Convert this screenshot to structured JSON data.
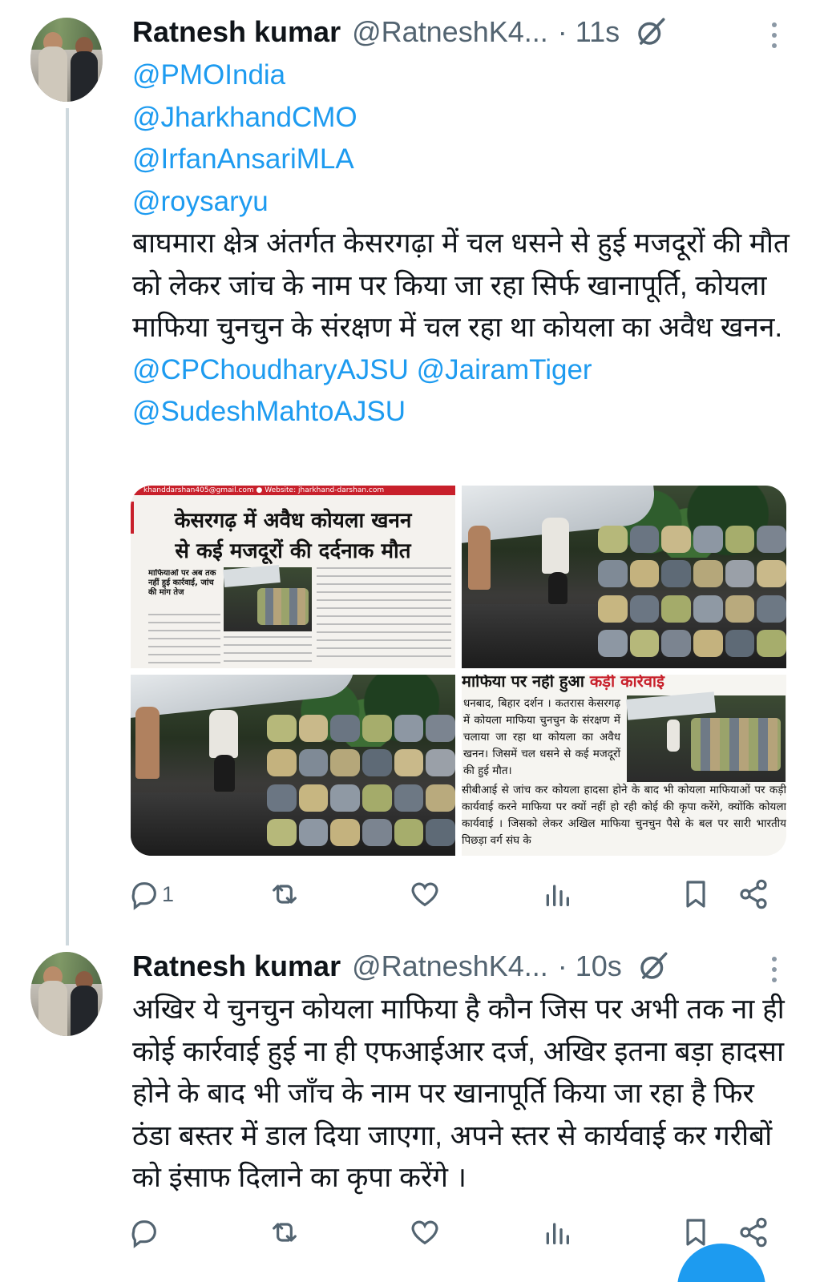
{
  "tweets": [
    {
      "author_name": "Ratnesh kumar",
      "author_handle": "@RatneshK4...",
      "time": "· 11s",
      "mentions_top": [
        "@PMOIndia",
        "@JharkhandCMO",
        "@IrfanAnsariMLA",
        "@roysaryu"
      ],
      "text": "बाघमारा क्षेत्र अंतर्गत केसरगढ़ा में चल धसने से हुई मजदूरों की मौत को लेकर जांच के नाम पर किया जा रहा सिर्फ खानापूर्ति, कोयला माफिया चुनचुन के संरक्षण में चल रहा था कोयला का अवैध खनन.",
      "mentions_bottom_line1_a": "@CPChoudharyAJSU",
      "mentions_bottom_line1_b": "@JairamTiger",
      "mentions_bottom_line2": "@SudeshMahtoAJSU",
      "reply_count": "1",
      "media": {
        "newspaper1": {
          "strip": "khanddarshan405@gmail.com   ● Website: jharkhand-darshan.com",
          "headline_line1": "केसरगढ़ में अवैध कोयला खनन",
          "headline_line2": "से कई मजदूरों की दर्दनाक मौत",
          "subhead": "माफियाओं पर अब तक नहीं हुई कार्रवाई, जांच की मांग तेज"
        },
        "newspaper2": {
          "top_black": "माफिया पर नहीं हुआ",
          "top_red": "कड़ी कार्रवाई",
          "col_text": "धनबाद, बिहार दर्शन । कतरास केसरगढ़ में कोयला माफिया चुनचुन के संरक्षण में चलाया जा रहा था कोयला का अवैध खनन। जिसमें चल धसने से कई मजदूरों की हुई मौत।",
          "full_text": "सीबीआई से जांच कर कोयला हादसा होने के बाद भी कोयला माफियाओं पर कड़ी कार्यवाई करने माफिया पर क्यों नहीं हो रही कोई की कृपा करेंगे, क्योंकि कोयला कार्यवाई । जिसको लेकर अखिल माफिया चुनचुन पैसे के बल पर सारी भारतीय पिछड़ा वर्ग संघ के"
        }
      }
    },
    {
      "author_name": "Ratnesh kumar",
      "author_handle": "@RatneshK4...",
      "time": "· 10s",
      "text": "अखिर ये चुनचुन कोयला माफिया है कौन जिस पर  अभी तक ना ही कोई कार्रवाई हुई ना ही एफआईआर दर्ज, अखिर इतना बड़ा हादसा होने के बाद भी जाँच के नाम पर खानापूर्ति किया जा रहा है फिर ठंडा बस्तर में डाल दिया जाएगा, अपने स्तर से कार्यवाई कर गरीबों को इंसाफ दिलाने का कृपा करेंगे ।"
    }
  ],
  "icons": [
    "grok-icon",
    "more-icon",
    "reply-icon",
    "retweet-icon",
    "like-icon",
    "views-icon",
    "bookmark-icon",
    "share-icon"
  ],
  "colors": {
    "link": "#1d9bf0",
    "secondary": "#536471",
    "text": "#0f1419",
    "thread_line": "#cfd9de"
  }
}
